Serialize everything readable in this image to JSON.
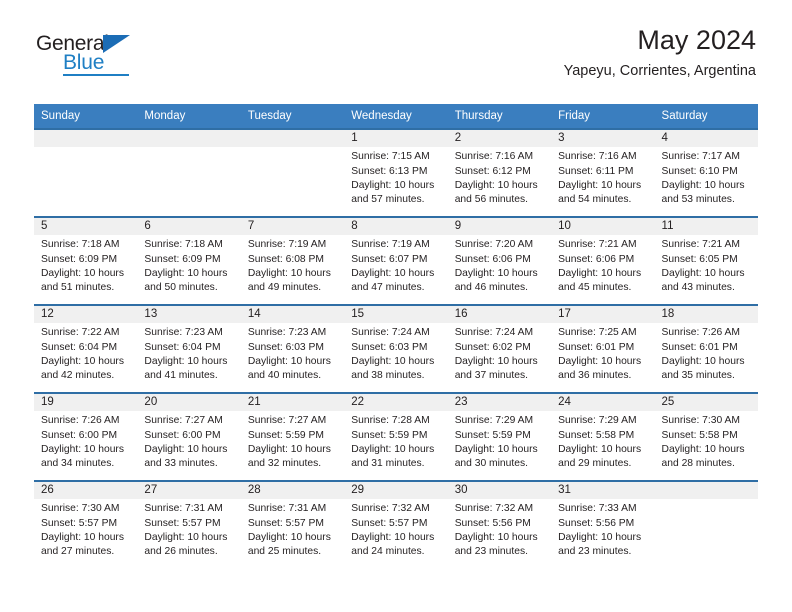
{
  "brand": {
    "name_top": "General",
    "name_bottom": "Blue",
    "accent_color": "#1f7fc4",
    "triangle_color": "#1b6cb5"
  },
  "header": {
    "title": "May 2024",
    "subtitle": "Yapeyu, Corrientes, Argentina"
  },
  "calendar": {
    "header_bg": "#3a7ebf",
    "row_divider": "#2f6ea5",
    "day_band_bg": "#f0f0f0",
    "weekdays": [
      "Sunday",
      "Monday",
      "Tuesday",
      "Wednesday",
      "Thursday",
      "Friday",
      "Saturday"
    ],
    "weeks": [
      [
        {
          "day": "",
          "empty": true
        },
        {
          "day": "",
          "empty": true
        },
        {
          "day": "",
          "empty": true
        },
        {
          "day": "1",
          "sunrise": "Sunrise: 7:15 AM",
          "sunset": "Sunset: 6:13 PM",
          "daylight_line1": "Daylight: 10 hours",
          "daylight_line2": "and 57 minutes."
        },
        {
          "day": "2",
          "sunrise": "Sunrise: 7:16 AM",
          "sunset": "Sunset: 6:12 PM",
          "daylight_line1": "Daylight: 10 hours",
          "daylight_line2": "and 56 minutes."
        },
        {
          "day": "3",
          "sunrise": "Sunrise: 7:16 AM",
          "sunset": "Sunset: 6:11 PM",
          "daylight_line1": "Daylight: 10 hours",
          "daylight_line2": "and 54 minutes."
        },
        {
          "day": "4",
          "sunrise": "Sunrise: 7:17 AM",
          "sunset": "Sunset: 6:10 PM",
          "daylight_line1": "Daylight: 10 hours",
          "daylight_line2": "and 53 minutes."
        }
      ],
      [
        {
          "day": "5",
          "sunrise": "Sunrise: 7:18 AM",
          "sunset": "Sunset: 6:09 PM",
          "daylight_line1": "Daylight: 10 hours",
          "daylight_line2": "and 51 minutes."
        },
        {
          "day": "6",
          "sunrise": "Sunrise: 7:18 AM",
          "sunset": "Sunset: 6:09 PM",
          "daylight_line1": "Daylight: 10 hours",
          "daylight_line2": "and 50 minutes."
        },
        {
          "day": "7",
          "sunrise": "Sunrise: 7:19 AM",
          "sunset": "Sunset: 6:08 PM",
          "daylight_line1": "Daylight: 10 hours",
          "daylight_line2": "and 49 minutes."
        },
        {
          "day": "8",
          "sunrise": "Sunrise: 7:19 AM",
          "sunset": "Sunset: 6:07 PM",
          "daylight_line1": "Daylight: 10 hours",
          "daylight_line2": "and 47 minutes."
        },
        {
          "day": "9",
          "sunrise": "Sunrise: 7:20 AM",
          "sunset": "Sunset: 6:06 PM",
          "daylight_line1": "Daylight: 10 hours",
          "daylight_line2": "and 46 minutes."
        },
        {
          "day": "10",
          "sunrise": "Sunrise: 7:21 AM",
          "sunset": "Sunset: 6:06 PM",
          "daylight_line1": "Daylight: 10 hours",
          "daylight_line2": "and 45 minutes."
        },
        {
          "day": "11",
          "sunrise": "Sunrise: 7:21 AM",
          "sunset": "Sunset: 6:05 PM",
          "daylight_line1": "Daylight: 10 hours",
          "daylight_line2": "and 43 minutes."
        }
      ],
      [
        {
          "day": "12",
          "sunrise": "Sunrise: 7:22 AM",
          "sunset": "Sunset: 6:04 PM",
          "daylight_line1": "Daylight: 10 hours",
          "daylight_line2": "and 42 minutes."
        },
        {
          "day": "13",
          "sunrise": "Sunrise: 7:23 AM",
          "sunset": "Sunset: 6:04 PM",
          "daylight_line1": "Daylight: 10 hours",
          "daylight_line2": "and 41 minutes."
        },
        {
          "day": "14",
          "sunrise": "Sunrise: 7:23 AM",
          "sunset": "Sunset: 6:03 PM",
          "daylight_line1": "Daylight: 10 hours",
          "daylight_line2": "and 40 minutes."
        },
        {
          "day": "15",
          "sunrise": "Sunrise: 7:24 AM",
          "sunset": "Sunset: 6:03 PM",
          "daylight_line1": "Daylight: 10 hours",
          "daylight_line2": "and 38 minutes."
        },
        {
          "day": "16",
          "sunrise": "Sunrise: 7:24 AM",
          "sunset": "Sunset: 6:02 PM",
          "daylight_line1": "Daylight: 10 hours",
          "daylight_line2": "and 37 minutes."
        },
        {
          "day": "17",
          "sunrise": "Sunrise: 7:25 AM",
          "sunset": "Sunset: 6:01 PM",
          "daylight_line1": "Daylight: 10 hours",
          "daylight_line2": "and 36 minutes."
        },
        {
          "day": "18",
          "sunrise": "Sunrise: 7:26 AM",
          "sunset": "Sunset: 6:01 PM",
          "daylight_line1": "Daylight: 10 hours",
          "daylight_line2": "and 35 minutes."
        }
      ],
      [
        {
          "day": "19",
          "sunrise": "Sunrise: 7:26 AM",
          "sunset": "Sunset: 6:00 PM",
          "daylight_line1": "Daylight: 10 hours",
          "daylight_line2": "and 34 minutes."
        },
        {
          "day": "20",
          "sunrise": "Sunrise: 7:27 AM",
          "sunset": "Sunset: 6:00 PM",
          "daylight_line1": "Daylight: 10 hours",
          "daylight_line2": "and 33 minutes."
        },
        {
          "day": "21",
          "sunrise": "Sunrise: 7:27 AM",
          "sunset": "Sunset: 5:59 PM",
          "daylight_line1": "Daylight: 10 hours",
          "daylight_line2": "and 32 minutes."
        },
        {
          "day": "22",
          "sunrise": "Sunrise: 7:28 AM",
          "sunset": "Sunset: 5:59 PM",
          "daylight_line1": "Daylight: 10 hours",
          "daylight_line2": "and 31 minutes."
        },
        {
          "day": "23",
          "sunrise": "Sunrise: 7:29 AM",
          "sunset": "Sunset: 5:59 PM",
          "daylight_line1": "Daylight: 10 hours",
          "daylight_line2": "and 30 minutes."
        },
        {
          "day": "24",
          "sunrise": "Sunrise: 7:29 AM",
          "sunset": "Sunset: 5:58 PM",
          "daylight_line1": "Daylight: 10 hours",
          "daylight_line2": "and 29 minutes."
        },
        {
          "day": "25",
          "sunrise": "Sunrise: 7:30 AM",
          "sunset": "Sunset: 5:58 PM",
          "daylight_line1": "Daylight: 10 hours",
          "daylight_line2": "and 28 minutes."
        }
      ],
      [
        {
          "day": "26",
          "sunrise": "Sunrise: 7:30 AM",
          "sunset": "Sunset: 5:57 PM",
          "daylight_line1": "Daylight: 10 hours",
          "daylight_line2": "and 27 minutes."
        },
        {
          "day": "27",
          "sunrise": "Sunrise: 7:31 AM",
          "sunset": "Sunset: 5:57 PM",
          "daylight_line1": "Daylight: 10 hours",
          "daylight_line2": "and 26 minutes."
        },
        {
          "day": "28",
          "sunrise": "Sunrise: 7:31 AM",
          "sunset": "Sunset: 5:57 PM",
          "daylight_line1": "Daylight: 10 hours",
          "daylight_line2": "and 25 minutes."
        },
        {
          "day": "29",
          "sunrise": "Sunrise: 7:32 AM",
          "sunset": "Sunset: 5:57 PM",
          "daylight_line1": "Daylight: 10 hours",
          "daylight_line2": "and 24 minutes."
        },
        {
          "day": "30",
          "sunrise": "Sunrise: 7:32 AM",
          "sunset": "Sunset: 5:56 PM",
          "daylight_line1": "Daylight: 10 hours",
          "daylight_line2": "and 23 minutes."
        },
        {
          "day": "31",
          "sunrise": "Sunrise: 7:33 AM",
          "sunset": "Sunset: 5:56 PM",
          "daylight_line1": "Daylight: 10 hours",
          "daylight_line2": "and 23 minutes."
        },
        {
          "day": "",
          "empty": true
        }
      ]
    ]
  }
}
